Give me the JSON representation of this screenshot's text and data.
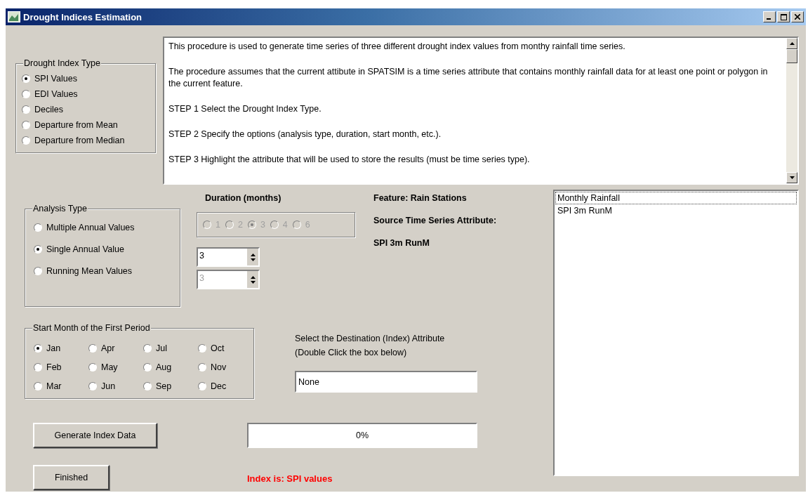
{
  "window": {
    "title": "Drought Indices Estimation"
  },
  "drought_index_type": {
    "label": "Drought Index Type",
    "options": [
      {
        "label": "SPI Values",
        "selected": true
      },
      {
        "label": "EDI Values",
        "selected": false
      },
      {
        "label": "Deciles",
        "selected": false
      },
      {
        "label": "Departure from Mean",
        "selected": false
      },
      {
        "label": "Departure from Median",
        "selected": false
      }
    ]
  },
  "description": {
    "paragraphs": [
      "This procedure is used to generate time series of three different drought index values from monthy rainfall time series.",
      "The procedure assumes that the current attibute in SPATSIM is a time series attribute that contains monthly rainfall data for at least one point or polygon in the current feature.",
      "STEP 1 Select the Drought Index Type.",
      "STEP 2 Specify the options (analysis type, duration, start month, etc.).",
      "STEP 3 Highlight the attribute that will be used to store the results (must be time series type)."
    ]
  },
  "analysis_type": {
    "label": "Analysis Type",
    "options": [
      {
        "label": "Multiple Annual Values",
        "selected": false
      },
      {
        "label": "Single Annual Value",
        "selected": true
      },
      {
        "label": "Running Mean Values",
        "selected": false
      }
    ]
  },
  "duration": {
    "label": "Duration (months)",
    "disabled": true,
    "options": [
      {
        "label": "1",
        "selected": false
      },
      {
        "label": "2",
        "selected": false
      },
      {
        "label": "3",
        "selected": true
      },
      {
        "label": "4",
        "selected": false
      },
      {
        "label": "6",
        "selected": false
      }
    ],
    "spinners": [
      {
        "value": "3",
        "disabled": false
      },
      {
        "value": "3",
        "disabled": true
      }
    ]
  },
  "feature_info": [
    "Feature: Rain Stations",
    "Source Time Series Attribute:",
    "SPI 3m RunM"
  ],
  "start_month": {
    "label": "Start Month of the First Period",
    "months": [
      {
        "label": "Jan",
        "selected": true
      },
      {
        "label": "Feb",
        "selected": false
      },
      {
        "label": "Mar",
        "selected": false
      },
      {
        "label": "Apr",
        "selected": false
      },
      {
        "label": "May",
        "selected": false
      },
      {
        "label": "Jun",
        "selected": false
      },
      {
        "label": "Jul",
        "selected": false
      },
      {
        "label": "Aug",
        "selected": false
      },
      {
        "label": "Sep",
        "selected": false
      },
      {
        "label": "Oct",
        "selected": false
      },
      {
        "label": "Nov",
        "selected": false
      },
      {
        "label": "Dec",
        "selected": false
      }
    ]
  },
  "destination": {
    "instructions": [
      "Select the Destination (Index) Attribute",
      "(Double Click the box below)"
    ],
    "value": "None"
  },
  "generate_button": "Generate Index Data",
  "progress": {
    "level": 0,
    "text": "0%"
  },
  "finished_button": "Finished",
  "status": "Index is: SPI values",
  "attributes": [
    {
      "label": "Monthly Rainfall",
      "selected": true
    },
    {
      "label": "SPI 3m RunM",
      "selected": false
    }
  ]
}
